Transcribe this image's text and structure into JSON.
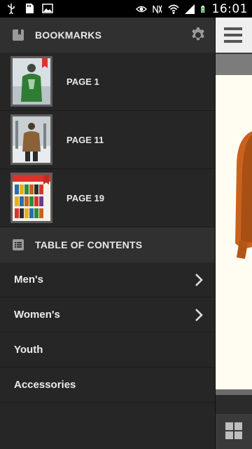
{
  "status_bar": {
    "time": "16:01",
    "icons": [
      "usb-icon",
      "sd-card-icon",
      "image-icon",
      "eye-icon",
      "mute-icon",
      "wifi-icon",
      "signal-icon",
      "battery-icon"
    ]
  },
  "drawer": {
    "bookmarks": {
      "title": "BOOKMARKS",
      "icon": "bookmark-icon",
      "settings_icon": "gear-icon",
      "items": [
        {
          "label": "PAGE 1"
        },
        {
          "label": "PAGE 11"
        },
        {
          "label": "PAGE 19"
        }
      ]
    },
    "toc": {
      "title": "TABLE OF CONTENTS",
      "icon": "list-icon",
      "items": [
        {
          "label": "Men's",
          "has_children": true
        },
        {
          "label": "Women's",
          "has_children": true
        },
        {
          "label": "Youth",
          "has_children": false
        },
        {
          "label": "Accessories",
          "has_children": false
        }
      ]
    }
  },
  "colors": {
    "drawer_bg": "#262626",
    "header_bg": "#303030",
    "accent_red": "#d9342b",
    "jacket_orange": "#c8621e"
  }
}
